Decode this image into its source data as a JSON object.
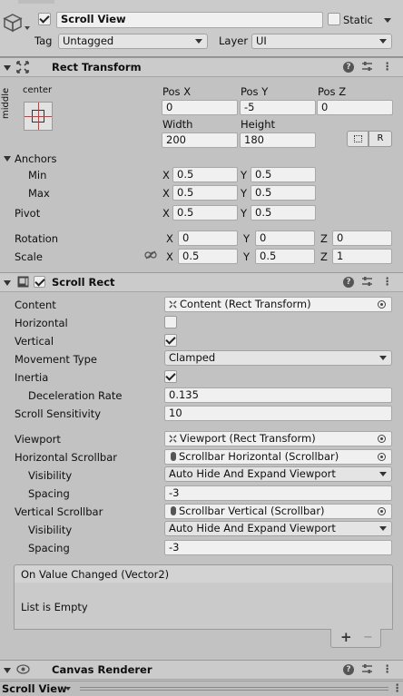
{
  "gameobject": {
    "name": "Scroll View",
    "active": true,
    "static_label": "Static",
    "static": false,
    "tag_label": "Tag",
    "tag_value": "Untagged",
    "layer_label": "Layer",
    "layer_value": "UI"
  },
  "rect_transform": {
    "title": "Rect Transform",
    "anchor_preset_top": "center",
    "anchor_preset_side": "middle",
    "posx_label": "Pos X",
    "posx": "0",
    "posy_label": "Pos Y",
    "posy": "-5",
    "posz_label": "Pos Z",
    "posz": "0",
    "width_label": "Width",
    "width": "200",
    "height_label": "Height",
    "height": "180",
    "raw_button": "R",
    "anchors_label": "Anchors",
    "min_label": "Min",
    "min_x": "0.5",
    "min_y": "0.5",
    "max_label": "Max",
    "max_x": "0.5",
    "max_y": "0.5",
    "pivot_label": "Pivot",
    "pivot_x": "0.5",
    "pivot_y": "0.5",
    "rotation_label": "Rotation",
    "rot_x": "0",
    "rot_y": "0",
    "rot_z": "0",
    "scale_label": "Scale",
    "scale_x": "0.5",
    "scale_y": "0.5",
    "scale_z": "1",
    "x": "X",
    "y": "Y",
    "z": "Z"
  },
  "scroll_rect": {
    "title": "Scroll Rect",
    "enabled": true,
    "content_label": "Content",
    "content_value": "Content (Rect Transform)",
    "horizontal_label": "Horizontal",
    "horizontal": false,
    "vertical_label": "Vertical",
    "vertical": true,
    "movement_label": "Movement Type",
    "movement_value": "Clamped",
    "inertia_label": "Inertia",
    "inertia": true,
    "decel_label": "Deceleration Rate",
    "decel_value": "0.135",
    "sensitivity_label": "Scroll Sensitivity",
    "sensitivity_value": "10",
    "viewport_label": "Viewport",
    "viewport_value": "Viewport (Rect Transform)",
    "hscroll_label": "Horizontal Scrollbar",
    "hscroll_value": "Scrollbar Horizontal (Scrollbar)",
    "hvis_label": "Visibility",
    "hvis_value": "Auto Hide And Expand Viewport",
    "hspacing_label": "Spacing",
    "hspacing_value": "-3",
    "vscroll_label": "Vertical Scrollbar",
    "vscroll_value": "Scrollbar Vertical (Scrollbar)",
    "vvis_label": "Visibility",
    "vvis_value": "Auto Hide And Expand Viewport",
    "vspacing_label": "Spacing",
    "vspacing_value": "-3",
    "event_title": "On Value Changed (Vector2)",
    "event_empty": "List is Empty",
    "add_label": "+",
    "remove_label": "−"
  },
  "canvas_renderer": {
    "title": "Canvas Renderer"
  },
  "footer": {
    "object_name": "Scroll View"
  }
}
